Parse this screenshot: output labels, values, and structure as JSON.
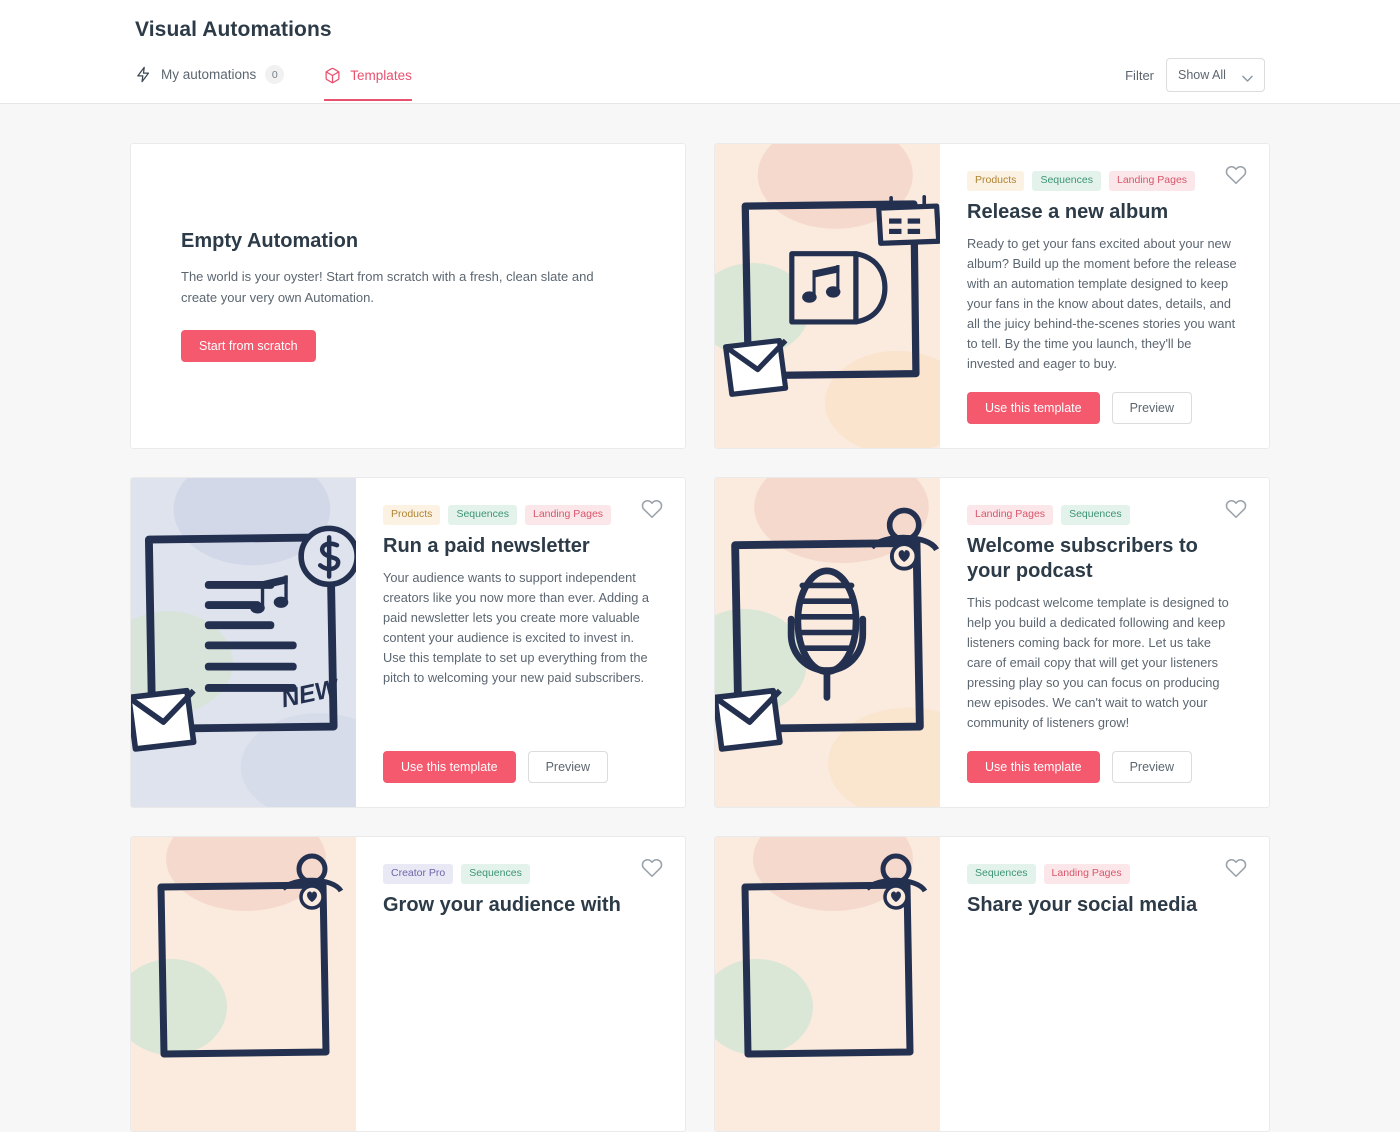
{
  "header": {
    "title": "Visual Automations",
    "tabs": [
      {
        "label": "My automations",
        "icon": "zap-icon",
        "badge": "0",
        "active": false
      },
      {
        "label": "Templates",
        "icon": "cube-icon",
        "badge": null,
        "active": true
      }
    ],
    "filter": {
      "label": "Filter",
      "value": "Show All",
      "icon": "chevron-down-icon"
    }
  },
  "colors": {
    "accent": "#f4596e",
    "active_tab": "#e8526e",
    "page_bg": "#f7f7f7",
    "card_bg": "#ffffff",
    "title": "#2c3b47",
    "body_text": "#5c6670",
    "tag_products_bg": "#fbf2e3",
    "tag_products_fg": "#b08433",
    "tag_sequences_bg": "#e3f3ec",
    "tag_sequences_fg": "#3d9473",
    "tag_landing_bg": "#fbe7e9",
    "tag_landing_fg": "#d8566b",
    "tag_creatorpro_bg": "#e9e8f5",
    "tag_creatorpro_fg": "#6b66a8",
    "illustration_stroke": "#23304f"
  },
  "empty_card": {
    "title": "Empty Automation",
    "description": "The world is your oyster! Start from scratch with a fresh, clean slate and create your very own Automation.",
    "button": "Start from scratch"
  },
  "buttons": {
    "use_template": "Use this template",
    "preview": "Preview",
    "favorite_icon": "heart-icon"
  },
  "templates": [
    {
      "tags": [
        {
          "label": "Products",
          "style": "products"
        },
        {
          "label": "Sequences",
          "style": "sequences"
        },
        {
          "label": "Landing Pages",
          "style": "landing"
        }
      ],
      "title": "Release a new album",
      "description": "Ready to get your fans excited about your new album? Build up the moment before the release with an automation template designed to keep your fans in the know about dates, details, and all the juicy behind-the-scenes stories you want to tell. By the time you launch, they'll be invested and eager to buy.",
      "thumbnail": "album-illustration",
      "thumbnail_bg": "#fbeade"
    },
    {
      "tags": [
        {
          "label": "Products",
          "style": "products"
        },
        {
          "label": "Sequences",
          "style": "sequences"
        },
        {
          "label": "Landing Pages",
          "style": "landing"
        }
      ],
      "title": "Run a paid newsletter",
      "description": "Your audience wants to support independent creators like you now more than ever. Adding a paid newsletter lets you create more valuable content your audience is excited to invest in. Use this template to set up everything from the pitch to welcoming your new paid subscribers.",
      "thumbnail": "newsletter-illustration",
      "thumbnail_bg": "#dfe3ee"
    },
    {
      "tags": [
        {
          "label": "Landing Pages",
          "style": "landing"
        },
        {
          "label": "Sequences",
          "style": "sequences"
        }
      ],
      "title": "Welcome subscribers to your podcast",
      "description": "This podcast welcome template is designed to help you build a dedicated following and keep listeners coming back for more. Let us take care of email copy that will get your listeners pressing play so you can focus on producing new episodes. We can't wait to watch your community of listeners grow!",
      "thumbnail": "podcast-illustration",
      "thumbnail_bg": "#fbeade"
    },
    {
      "tags": [
        {
          "label": "Creator Pro",
          "style": "creatorpro"
        },
        {
          "label": "Sequences",
          "style": "sequences"
        }
      ],
      "title": "Grow your audience with",
      "description": "",
      "thumbnail": "audience-illustration",
      "thumbnail_bg": "#fbeade"
    },
    {
      "tags": [
        {
          "label": "Sequences",
          "style": "sequences"
        },
        {
          "label": "Landing Pages",
          "style": "landing"
        }
      ],
      "title": "Share your social media",
      "description": "",
      "thumbnail": "social-illustration",
      "thumbnail_bg": "#fbeade"
    }
  ]
}
